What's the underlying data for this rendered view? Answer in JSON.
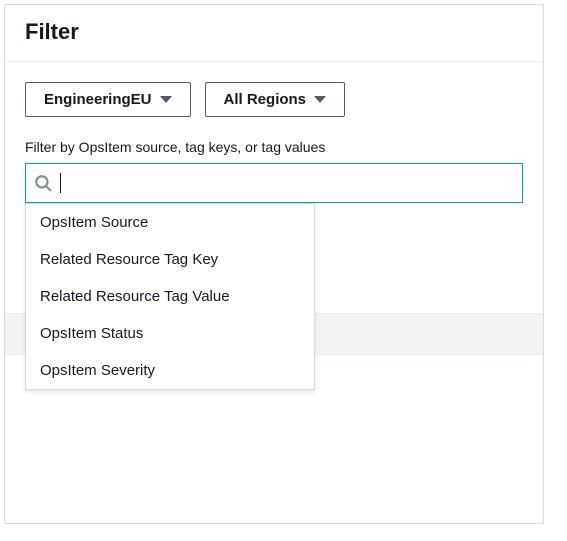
{
  "panel": {
    "title": "Filter"
  },
  "dropdowns": {
    "account": "EngineeringEU",
    "region": "All Regions"
  },
  "filter": {
    "label": "Filter by OpsItem source, tag keys, or tag values",
    "value": ""
  },
  "suggestions": [
    "OpsItem Source",
    "Related Resource Tag Key",
    "Related Resource Tag Value",
    "OpsItem Status",
    "OpsItem Severity"
  ]
}
